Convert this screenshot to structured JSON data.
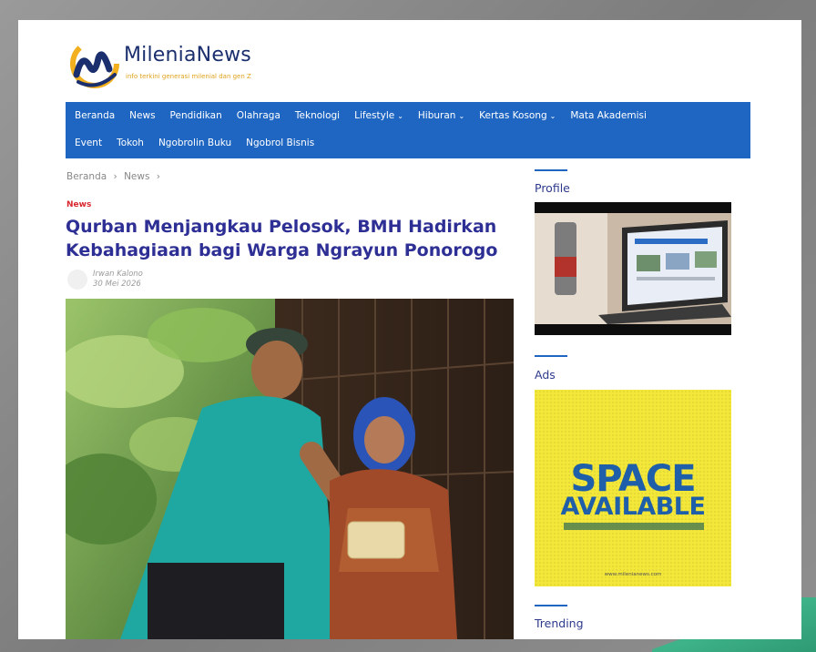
{
  "site": {
    "name": "MileniaNews",
    "tagline": "info terkini generasi milenial dan gen Z",
    "accent_color": "#1f66c2",
    "title_color": "#2e2f94",
    "logo_icon": "m-swoosh-logo-icon"
  },
  "nav": {
    "row1": [
      {
        "label": "Beranda"
      },
      {
        "label": "News"
      },
      {
        "label": "Pendidikan"
      },
      {
        "label": "Olahraga"
      },
      {
        "label": "Teknologi"
      },
      {
        "label": "Lifestyle",
        "caret": "⌄"
      },
      {
        "label": "Hiburan",
        "caret": "⌄"
      },
      {
        "label": "Kertas Kosong",
        "caret": "⌄"
      },
      {
        "label": "Mata Akademisi"
      }
    ],
    "row2": [
      {
        "label": "Event"
      },
      {
        "label": "Tokoh"
      },
      {
        "label": "Ngobrolin Buku"
      },
      {
        "label": "Ngobrol Bisnis"
      }
    ]
  },
  "breadcrumb": {
    "home": "Beranda",
    "sep1": "›",
    "section": "News",
    "sep2": "›"
  },
  "article": {
    "category": "News",
    "title": "Qurban Menjangkau Pelosok, BMH Hadirkan Kebahagiaan bagi Warga Ngrayun Ponorogo",
    "author": "Irwan Kalono",
    "date": "30 Mei 2026"
  },
  "sidebar": {
    "profile_title": "Profile",
    "ads_title": "Ads",
    "trending_title": "Trending",
    "ad": {
      "line1": "SPACE",
      "line2": "AVAILABLE",
      "url": "www.milenianews.com"
    }
  }
}
